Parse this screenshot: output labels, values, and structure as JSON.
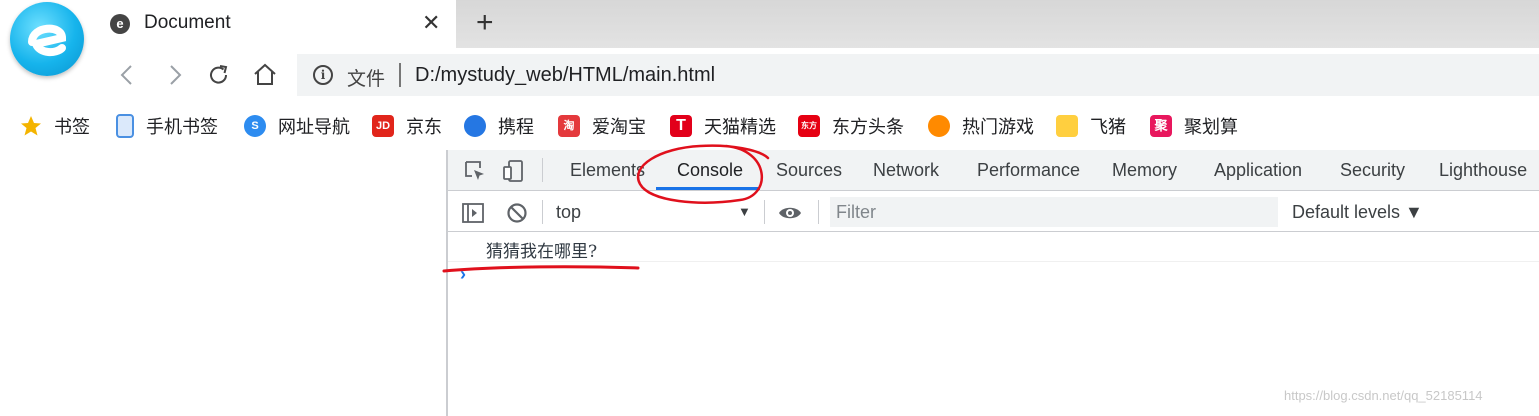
{
  "tab": {
    "title": "Document",
    "close": "✕"
  },
  "newtab": "+",
  "address": {
    "scheme": "文件",
    "url": "D:/mystudy_web/HTML/main.html"
  },
  "bookmarks": [
    {
      "label": "书签",
      "icon": "star-icon",
      "color": "#f4b400"
    },
    {
      "label": "手机书签",
      "icon": "phone-icon",
      "color": "#4a90e2"
    },
    {
      "label": "网址导航",
      "icon": "nav-icon",
      "color": "#2d8cf0"
    },
    {
      "label": "京东",
      "icon": "jd-icon",
      "color": "#e1251b",
      "glyph": "JD"
    },
    {
      "label": "携程",
      "icon": "ctrip-icon",
      "color": "#2577e3"
    },
    {
      "label": "爱淘宝",
      "icon": "taobao-icon",
      "color": "#e4393c",
      "glyph": "淘"
    },
    {
      "label": "天猫精选",
      "icon": "tmall-icon",
      "color": "#e2001a",
      "glyph": "T"
    },
    {
      "label": "东方头条",
      "icon": "dftt-icon",
      "color": "#e60012",
      "glyph": "东方"
    },
    {
      "label": "热门游戏",
      "icon": "game-icon",
      "color": "#ff8a00"
    },
    {
      "label": "飞猪",
      "icon": "fliggy-icon",
      "color": "#ffcf3f"
    },
    {
      "label": "聚划算",
      "icon": "juhuasuan-icon",
      "color": "#e8175d",
      "glyph": "聚"
    }
  ],
  "devtools": {
    "tabs": [
      "Elements",
      "Console",
      "Sources",
      "Network",
      "Performance",
      "Memory",
      "Application",
      "Security",
      "Lighthouse"
    ],
    "active_tab": "Console",
    "context": "top",
    "filter_placeholder": "Filter",
    "levels": "Default levels ▼",
    "messages": [
      "猜猜我在哪里?"
    ],
    "prompt": "›"
  },
  "watermark": "https://blog.csdn.net/qq_52185114",
  "colors": {
    "accent": "#1a73e8",
    "annotation": "#e0101c"
  }
}
